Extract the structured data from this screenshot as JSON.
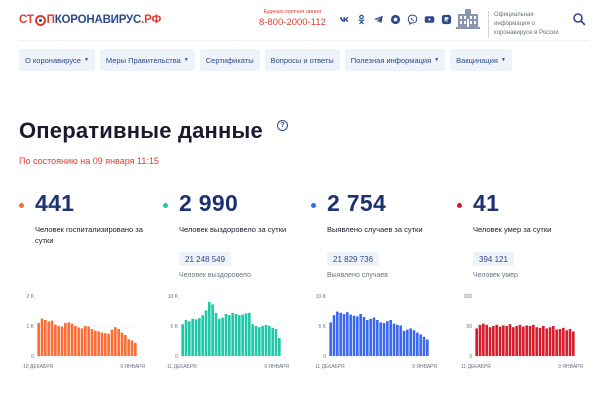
{
  "header": {
    "logo": {
      "stop_prefix": "СТ",
      "stop_suffix": "П",
      "name": "КОРОНАВИРУС",
      "domain": ".РФ"
    },
    "hotline": {
      "label": "Единая горячая линия",
      "phone": "8-800-2000-112"
    },
    "socials": [
      "vk-icon",
      "ok-icon",
      "telegram-icon",
      "gosuslugi-icon",
      "viber-icon",
      "youtube-icon",
      "rutube-icon"
    ],
    "official_text": "Официальная информация о коронавирусе в России"
  },
  "nav": [
    {
      "label": "О коронавирусе",
      "has_dropdown": true
    },
    {
      "label": "Меры Правительства",
      "has_dropdown": true
    },
    {
      "label": "Сертификаты",
      "has_dropdown": false
    },
    {
      "label": "Вопросы и ответы",
      "has_dropdown": false
    },
    {
      "label": "Полезная информация",
      "has_dropdown": true
    },
    {
      "label": "Вакцинация",
      "has_dropdown": true
    }
  ],
  "page": {
    "title": "Оперативные данные",
    "help_glyph": "?",
    "as_of": "По состоянию на 09 января 11:15"
  },
  "colors": {
    "hospitalized": "#ff6b35",
    "recovered": "#1ec7a5",
    "infected": "#3a67f0",
    "died": "#d61c2b",
    "brand_blue": "#2e4a8e",
    "brand_red": "#e03c31"
  },
  "stats": [
    {
      "value": "441",
      "desc": "Человек госпитализировано за сутки",
      "total": "",
      "total_label": ""
    },
    {
      "value": "2 990",
      "desc": "Человек выздоровело за сутки",
      "total": "21 248 549",
      "total_label": "Человек выздоровело"
    },
    {
      "value": "2 754",
      "desc": "Выявлено случаев за сутки",
      "total": "21 829 736",
      "total_label": "Выявлено случаев"
    },
    {
      "value": "41",
      "desc": "Человек умер за сутки",
      "total": "394 121",
      "total_label": "Человек умер"
    }
  ],
  "chart_data": [
    {
      "type": "bar",
      "series_key": "hospitalized",
      "y_ticks": [
        "2 K",
        "1 K",
        "0"
      ],
      "ylim": [
        0,
        2000
      ],
      "x_start": "10 ДЕКАБРЯ",
      "x_end": "9 ЯНВАРЯ",
      "values": [
        1100,
        1250,
        1200,
        1150,
        1180,
        1050,
        1000,
        980,
        1100,
        1120,
        1080,
        1000,
        950,
        920,
        1000,
        980,
        900,
        850,
        820,
        780,
        760,
        740,
        880,
        960,
        900,
        780,
        700,
        560,
        520,
        441
      ]
    },
    {
      "type": "bar",
      "series_key": "recovered",
      "y_ticks": [
        "10 K",
        "5 K",
        "0"
      ],
      "ylim": [
        0,
        10000
      ],
      "x_start": "11 ДЕКАБРЯ",
      "x_end": "9 ЯНВАРЯ",
      "values": [
        5300,
        6000,
        5800,
        6200,
        6100,
        6300,
        6800,
        7600,
        9000,
        8600,
        7200,
        6200,
        6400,
        7000,
        6800,
        7200,
        7000,
        6800,
        6900,
        7100,
        7200,
        5300,
        5000,
        4800,
        5000,
        5200,
        5000,
        4700,
        4500,
        2990
      ]
    },
    {
      "type": "bar",
      "series_key": "infected",
      "y_ticks": [
        "10 K",
        "5 K",
        "0"
      ],
      "ylim": [
        0,
        10000
      ],
      "x_start": "11 ДЕКАБРЯ",
      "x_end": "9 ЯНВАРЯ",
      "values": [
        5600,
        6800,
        7400,
        7200,
        7000,
        7300,
        6900,
        6700,
        6600,
        7000,
        6500,
        6000,
        6200,
        6400,
        6000,
        5600,
        5500,
        5800,
        6000,
        5400,
        5200,
        5100,
        4200,
        4400,
        4600,
        4300,
        3900,
        3600,
        3200,
        2754
      ]
    },
    {
      "type": "bar",
      "series_key": "died",
      "y_ticks": [
        "100",
        "50",
        "0"
      ],
      "ylim": [
        0,
        100
      ],
      "x_start": "11 ДЕКАБРЯ",
      "x_end": "9 ЯНВАРЯ",
      "values": [
        46,
        52,
        54,
        52,
        48,
        50,
        52,
        49,
        51,
        50,
        53,
        48,
        50,
        52,
        49,
        51,
        50,
        52,
        48,
        47,
        50,
        46,
        48,
        50,
        44,
        45,
        47,
        43,
        45,
        41
      ]
    }
  ]
}
